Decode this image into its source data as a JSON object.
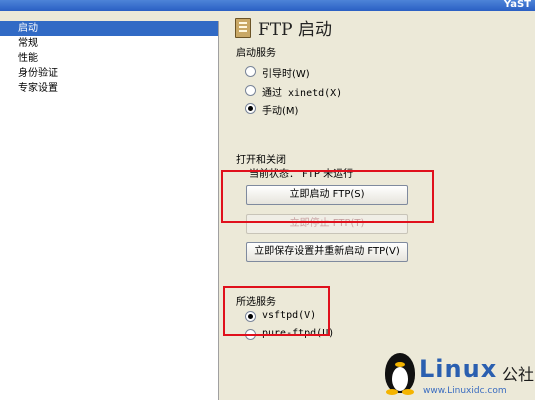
{
  "window": {
    "title": "YaST"
  },
  "sidebar": {
    "items": [
      {
        "label": "启动",
        "selected": true
      },
      {
        "label": "常规",
        "selected": false
      },
      {
        "label": "性能",
        "selected": false
      },
      {
        "label": "身份验证",
        "selected": false
      },
      {
        "label": "专家设置",
        "selected": false
      }
    ]
  },
  "header": {
    "title": "FTP 启动",
    "icon": "ftp-document-icon"
  },
  "start_service": {
    "label": "启动服务",
    "options": [
      {
        "label": "引导时(W)",
        "checked": false
      },
      {
        "label": "通过 xinetd(X)",
        "checked": false
      },
      {
        "label": "手动(M)",
        "checked": true
      }
    ]
  },
  "toggle": {
    "label": "打开和关闭",
    "status": "当前状态：  FTP 未运行",
    "start_button": "立即启动 FTP(S)",
    "stop_button": "立即停止 FTP(T)",
    "save_restart_button": "立即保存设置并重新启动 FTP(V)"
  },
  "selected_service": {
    "label": "所选服务",
    "options": [
      {
        "label": "vsftpd(V)",
        "checked": true
      },
      {
        "label": "pure-ftpd(U)",
        "checked": false
      }
    ]
  },
  "watermark": {
    "brand": "Linux",
    "brand_cn": "公社",
    "url": "www.Linuxidc.com"
  },
  "colors": {
    "highlight_border": "#e0101c",
    "selection": "#316ac5",
    "title_bar": "#2a5fc3"
  }
}
